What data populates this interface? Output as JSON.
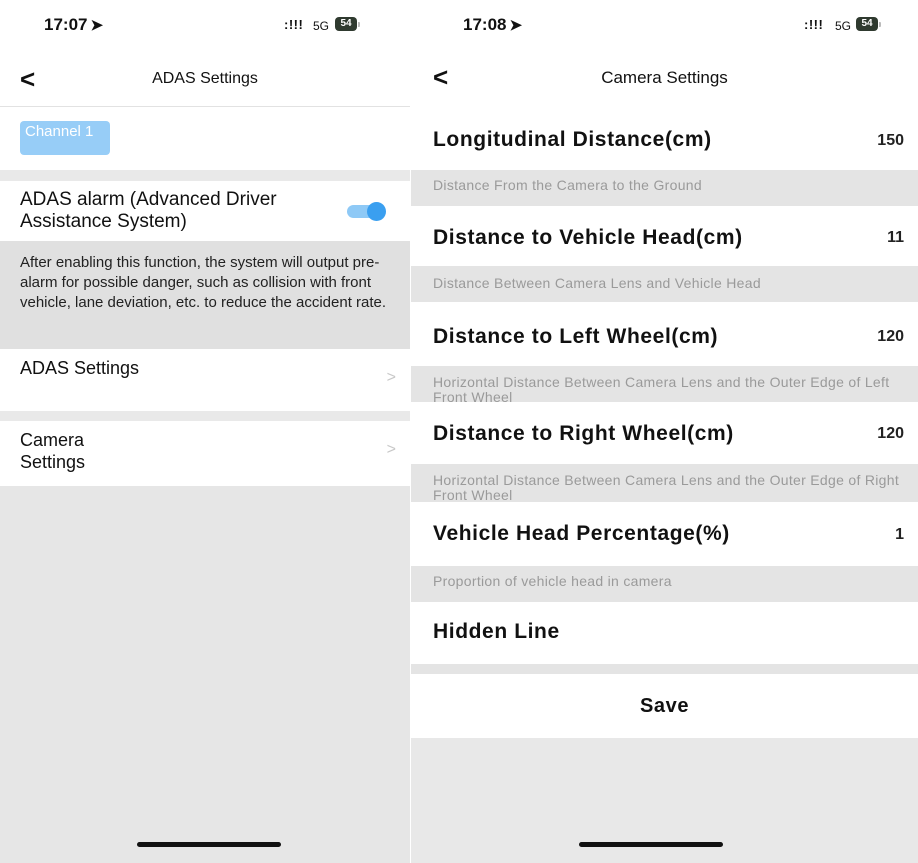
{
  "left": {
    "status": {
      "time": "17:07",
      "signal": ":!!!",
      "network": "5G",
      "battery": "54"
    },
    "nav": {
      "title": "ADAS Settings",
      "back": "<"
    },
    "channel": "Channel 1",
    "alarm": {
      "label": "ADAS alarm (Advanced Driver Assistance System)",
      "enabled": true
    },
    "description": "After enabling this function, the system will output pre-alarm for possible danger, such as collision with front vehicle, lane deviation, etc. to reduce the accident rate.",
    "menu": [
      {
        "label": "ADAS Settings",
        "chevron": ">"
      },
      {
        "label": "Camera Settings",
        "chevron": ">"
      }
    ]
  },
  "right": {
    "status": {
      "time": "17:08",
      "signal": ":!!!",
      "network": "5G",
      "battery": "54"
    },
    "nav": {
      "title": "Camera Settings",
      "back": "<"
    },
    "items": [
      {
        "label": "Longitudinal Distance(cm)",
        "value": "150",
        "hint": "Distance From the Camera to the Ground"
      },
      {
        "label": "Distance to Vehicle Head(cm)",
        "value": "11",
        "hint": "Distance Between Camera Lens and Vehicle Head"
      },
      {
        "label": "Distance to Left Wheel(cm)",
        "value": "120",
        "hint": "Horizontal Distance Between Camera Lens and the Outer Edge of Left Front Wheel"
      },
      {
        "label": "Distance to Right Wheel(cm)",
        "value": "120",
        "hint": "Horizontal Distance Between Camera Lens and the Outer Edge of Right Front Wheel"
      },
      {
        "label": "Vehicle Head Percentage(%)",
        "value": "1",
        "hint": "Proportion of vehicle head in camera"
      },
      {
        "label": "Hidden Line"
      }
    ],
    "save_label": "Save"
  },
  "colors": {
    "toggle_on": "#3a9ff0",
    "channel_chip": "#97cdf7",
    "section_gray": "#e4e4e4"
  }
}
